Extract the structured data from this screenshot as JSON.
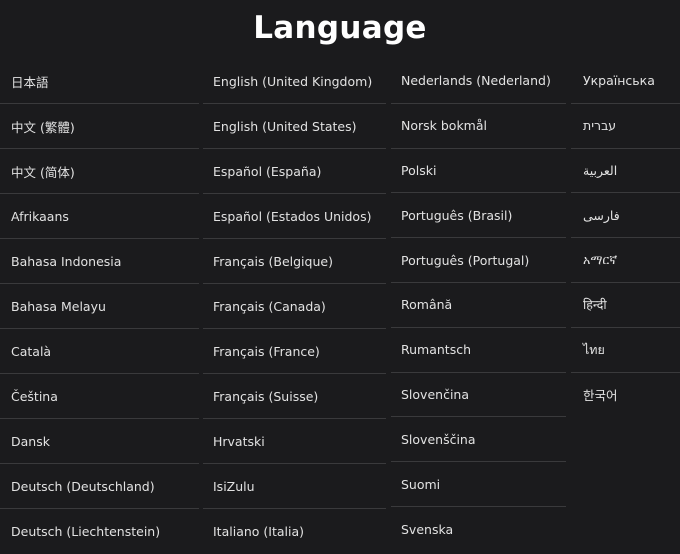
{
  "title": "Language",
  "columns": [
    [
      "日本語",
      "中文 (繁體)",
      "中文 (简体)",
      "Afrikaans",
      "Bahasa Indonesia",
      "Bahasa Melayu",
      "Català",
      "Čeština",
      "Dansk",
      "Deutsch (Deutschland)",
      "Deutsch (Liechtenstein)"
    ],
    [
      "English (United Kingdom)",
      "English (United States)",
      "Español (España)",
      "Español (Estados Unidos)",
      "Français (Belgique)",
      "Français (Canada)",
      "Français (France)",
      "Français (Suisse)",
      "Hrvatski",
      "IsiZulu",
      "Italiano (Italia)"
    ],
    [
      "Nederlands (Nederland)",
      "Norsk bokmål",
      "Polski",
      "Português (Brasil)",
      "Português (Portugal)",
      "Română",
      "Rumantsch",
      "Slovenčina",
      "Slovenščina",
      "Suomi",
      "Svenska"
    ],
    [
      "Українська",
      "עברית",
      "العربية",
      "فارسی",
      "አማርኛ",
      "हिन्दी",
      "ไทย",
      "한국어"
    ]
  ]
}
